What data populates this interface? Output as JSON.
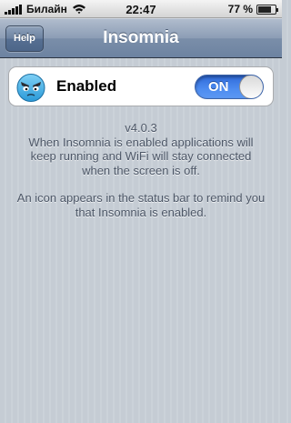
{
  "status_bar": {
    "carrier": "Билайн",
    "time": "22:47",
    "battery_percent": "77 %",
    "battery_level": 0.77
  },
  "nav": {
    "help_label": "Help",
    "title": "Insomnia"
  },
  "toggle_cell": {
    "label": "Enabled",
    "switch_label": "ON",
    "switch_on": true
  },
  "info": {
    "version": "v4.0.3",
    "line1": "When Insomnia is enabled applications will",
    "line2": "keep running and WiFi will stay connected",
    "line3": "when the screen is off.",
    "line4": "An icon appears in the status bar to remind you",
    "line5": "that Insomnia is enabled."
  },
  "colors": {
    "background": "#c5ccd4",
    "navbar": "#6d83a1",
    "switch_on": "#4d8cf0",
    "info_text": "#4d5767"
  }
}
